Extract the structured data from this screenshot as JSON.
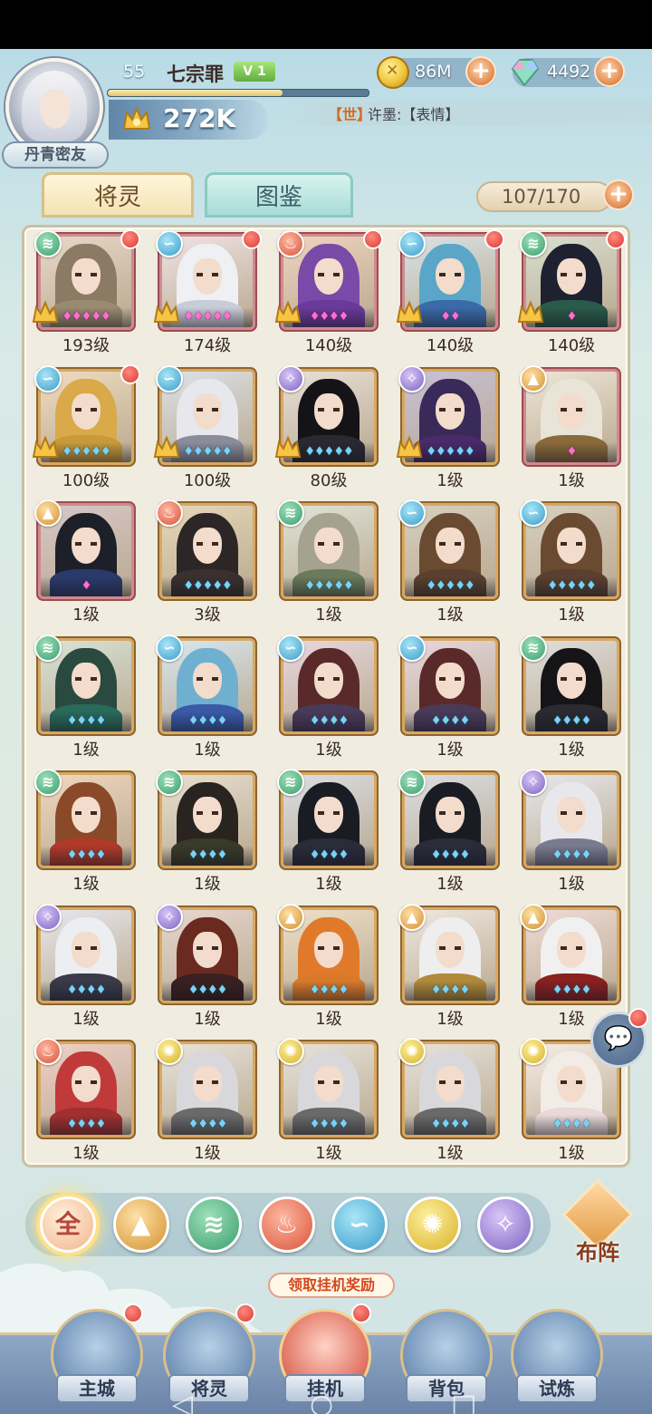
{
  "player": {
    "level": "55",
    "name": "七宗罪",
    "vip": "V 1",
    "exp_fraction": 0.67,
    "power": "272K",
    "title_tag": "丹青密友"
  },
  "resources": {
    "gold": "86M",
    "gems": "4492",
    "plus": "+"
  },
  "chat": {
    "channel": "【世】",
    "message": "许墨:【表情】"
  },
  "tabs": [
    {
      "label": "将灵",
      "active": true
    },
    {
      "label": "图鉴",
      "active": false
    }
  ],
  "roster_count": "107/170",
  "heroes": [
    {
      "element": "wind",
      "level": "193级",
      "frame": "red",
      "stars": "red5",
      "dot": true,
      "crest": true
    },
    {
      "element": "water",
      "level": "174级",
      "frame": "red",
      "stars": "red5",
      "dot": true,
      "crest": true
    },
    {
      "element": "fire",
      "level": "140级",
      "frame": "red",
      "stars": "red4",
      "dot": true,
      "crest": true
    },
    {
      "element": "water",
      "level": "140级",
      "frame": "red",
      "stars": "red2",
      "dot": true,
      "crest": true
    },
    {
      "element": "wind",
      "level": "140级",
      "frame": "red",
      "stars": "red1",
      "dot": true,
      "crest": true
    },
    {
      "element": "water",
      "level": "100级",
      "frame": "gold",
      "stars": "blue5",
      "dot": true,
      "crest": true
    },
    {
      "element": "water",
      "level": "100级",
      "frame": "gold",
      "stars": "blue5",
      "dot": false,
      "crest": true
    },
    {
      "element": "dark",
      "level": "80级",
      "frame": "gold",
      "stars": "blue5",
      "dot": false,
      "crest": true
    },
    {
      "element": "dark",
      "level": "1级",
      "frame": "gold",
      "stars": "blue5",
      "dot": false,
      "crest": true
    },
    {
      "element": "mountain",
      "level": "1级",
      "frame": "red",
      "stars": "red1",
      "dot": false,
      "crest": false
    },
    {
      "element": "mountain",
      "level": "1级",
      "frame": "red",
      "stars": "red1",
      "dot": false,
      "crest": false
    },
    {
      "element": "fire",
      "level": "3级",
      "frame": "gold",
      "stars": "blue5",
      "dot": false,
      "crest": false
    },
    {
      "element": "wind",
      "level": "1级",
      "frame": "gold",
      "stars": "blue5",
      "dot": false,
      "crest": false
    },
    {
      "element": "water",
      "level": "1级",
      "frame": "gold",
      "stars": "blue5",
      "dot": false,
      "crest": false
    },
    {
      "element": "water",
      "level": "1级",
      "frame": "gold",
      "stars": "blue5",
      "dot": false,
      "crest": false
    },
    {
      "element": "wind",
      "level": "1级",
      "frame": "gold",
      "stars": "blue4",
      "dot": false,
      "crest": false
    },
    {
      "element": "water",
      "level": "1级",
      "frame": "gold",
      "stars": "blue4",
      "dot": false,
      "crest": false
    },
    {
      "element": "water",
      "level": "1级",
      "frame": "gold",
      "stars": "blue4",
      "dot": false,
      "crest": false
    },
    {
      "element": "water",
      "level": "1级",
      "frame": "gold",
      "stars": "blue4",
      "dot": false,
      "crest": false
    },
    {
      "element": "wind",
      "level": "1级",
      "frame": "gold",
      "stars": "blue4",
      "dot": false,
      "crest": false
    },
    {
      "element": "wind",
      "level": "1级",
      "frame": "gold",
      "stars": "blue4",
      "dot": false,
      "crest": false
    },
    {
      "element": "wind",
      "level": "1级",
      "frame": "gold",
      "stars": "blue4",
      "dot": false,
      "crest": false
    },
    {
      "element": "wind",
      "level": "1级",
      "frame": "gold",
      "stars": "blue4",
      "dot": false,
      "crest": false
    },
    {
      "element": "wind",
      "level": "1级",
      "frame": "gold",
      "stars": "blue4",
      "dot": false,
      "crest": false
    },
    {
      "element": "dark",
      "level": "1级",
      "frame": "gold",
      "stars": "blue4",
      "dot": false,
      "crest": false
    },
    {
      "element": "dark",
      "level": "1级",
      "frame": "gold",
      "stars": "blue4",
      "dot": false,
      "crest": false
    },
    {
      "element": "dark",
      "level": "1级",
      "frame": "gold",
      "stars": "blue4",
      "dot": false,
      "crest": false
    },
    {
      "element": "mountain",
      "level": "1级",
      "frame": "gold",
      "stars": "blue4",
      "dot": false,
      "crest": false
    },
    {
      "element": "mountain",
      "level": "1级",
      "frame": "gold",
      "stars": "blue4",
      "dot": false,
      "crest": false
    },
    {
      "element": "mountain",
      "level": "1级",
      "frame": "gold",
      "stars": "blue4",
      "dot": false,
      "crest": false
    },
    {
      "element": "fire",
      "level": "1级",
      "frame": "gold",
      "stars": "blue4",
      "dot": false,
      "crest": false
    },
    {
      "element": "light",
      "level": "1级",
      "frame": "gold",
      "stars": "blue4",
      "dot": false,
      "crest": false
    },
    {
      "element": "light",
      "level": "1级",
      "frame": "gold",
      "stars": "blue4",
      "dot": false,
      "crest": false
    },
    {
      "element": "light",
      "level": "1级",
      "frame": "gold",
      "stars": "blue4",
      "dot": false,
      "crest": false
    },
    {
      "element": "light",
      "level": "1级",
      "frame": "gold",
      "stars": "blue4",
      "dot": false,
      "crest": false
    }
  ],
  "filters": [
    {
      "key": "all",
      "label": "全",
      "active": true
    },
    {
      "key": "mountain",
      "label": "",
      "active": false
    },
    {
      "key": "wind",
      "label": "",
      "active": false
    },
    {
      "key": "fire",
      "label": "",
      "active": false
    },
    {
      "key": "water",
      "label": "",
      "active": false
    },
    {
      "key": "light",
      "label": "",
      "active": false
    },
    {
      "key": "dark",
      "label": "",
      "active": false
    }
  ],
  "deploy_label": "布阵",
  "idle_reward_tip": "领取挂机奖励",
  "nav": [
    {
      "label": "主城",
      "dot": true,
      "active": false
    },
    {
      "label": "将灵",
      "dot": true,
      "active": false
    },
    {
      "label": "挂机",
      "dot": true,
      "active": true
    },
    {
      "label": "背包",
      "dot": false,
      "active": false
    },
    {
      "label": "试炼",
      "dot": false,
      "active": false
    }
  ],
  "colors": {
    "element_wind": "#3a9e6b",
    "element_water": "#3b9cc9",
    "element_fire": "#d8553a",
    "element_mountain": "#d3912f",
    "element_light": "#d7b227",
    "element_dark": "#7e63c2",
    "notification_red": "#d93a2f"
  }
}
